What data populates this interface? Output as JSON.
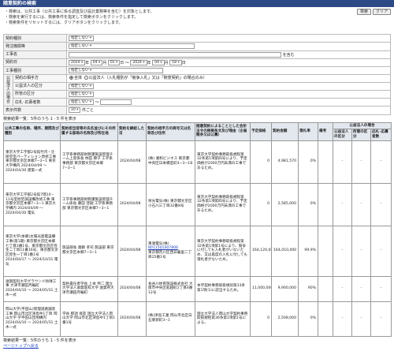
{
  "page_title": "随意契約の検索",
  "notes": [
    "・検索は、公共工事（公共工事に係る調査及び設計業務等を含む）を対象とします。",
    "・検索を実行するには、検索条件を指定して検索ボタンをクリックします。",
    "・検索条件をリセットするには、クリアボタンをクリックします。"
  ],
  "buttons": {
    "search": "検索",
    "clear": "クリア"
  },
  "form": {
    "contract_type_label": "契約種別",
    "contract_type_value": "指定しない",
    "orderer_label": "発注機関等",
    "orderer_value": "指定しない",
    "work_name_label": "工事名",
    "includes": "を含む",
    "date_label": "契約日",
    "date_from": {
      "year": "2024",
      "year_u": "年",
      "month": "04",
      "month_u": "月",
      "day": "01",
      "day_u": "日"
    },
    "tilde": "〜",
    "date_to": {
      "year": "2024",
      "year_u": "年",
      "month": "04",
      "month_u": "月",
      "day": "18",
      "day_u": "日"
    },
    "work_type_label": "工事種別",
    "work_type_value": "指定しない",
    "group_label": "公益法人の場合",
    "counterparty_label": "契約の相手方",
    "radio_all": "全体",
    "radio_public": "公益法人（入札種別が「競争入札」又は「随意契約」の場合のみ）",
    "category_label": "公益法人の区分",
    "category_value": "指定しない",
    "ministry_label": "所管の区分",
    "ministry_value": "指定しない",
    "bidders_label": "応札･応募者数",
    "bidders_value": "指定しない",
    "display_label": "表示件数",
    "display_value": "10",
    "display_unit": "件ごと"
  },
  "summary": "検索結果一覧：5件のうち 1 - 5 件を表示",
  "table": {
    "headers": {
      "work_name": "公共工事の名称、場所、期間及び種別",
      "official": "契約担当官等の氏名並びにその所属する部局の名称及び所在地",
      "date": "契約を締結した日",
      "contractor": "契約の相手方の商号又は名称及び住所",
      "reason": "随意契約によることとした会計法令の根拠条文及び理由（企画競争又は公募）",
      "estimate": "予定価格",
      "amount": "契約金額",
      "rate": "落札率",
      "note": "備考",
      "group": "公益法人の場合",
      "category": "公益法人の区分",
      "ministry": "所管の区分",
      "bidders": "応札･応募者数"
    },
    "rows": [
      {
        "work_name": "東京大学工学部2号館竹内・辻研究室パーティション改修工事 東京都文京区本郷7−3−1 東京大学構内 2024/04/09 〜 2024/04/30 建築一式",
        "official": "工学系事務部財務課施設管理チーム上席係長 林田 節子 工学系事務部 東京都文京区本郷7−3−1",
        "date": "2024/04/08",
        "contractor": "(株) 湘和ビジネス 東京都中央区日本橋室町4−3−18",
        "contractor_link": "",
        "reason": "東京大学契約事務取扱規程第32条第1項第四号により、予定価格が2000万円未満の工事であるため。",
        "estimate": "0",
        "amount": "4,981,570",
        "rate": "0%",
        "note": "",
        "category": "-",
        "ministry": "-",
        "bidders": "-"
      },
      {
        "work_name": "東京大学工学部2号館7階10・11号室他空調設備改修工事 東京都文京区本郷7−3−1 東京大学構内 2024/04/09 〜 2024/04/30 電気",
        "official": "工学系事務部財務課施設管理チーム係長 藤田 啓嗣 工学系事務部 東京都文京区本郷7−3−1",
        "date": "2024/04/08",
        "contractor": "栄光電気(株) 東京都文京区小石川三丁目32番8号",
        "contractor_link": "",
        "reason": "東京大学契約事務取扱規程第32条第1項第四号により、予定価格が2000万円未満の工事であるため。",
        "estimate": "0",
        "amount": "2,585,000",
        "rate": "0%",
        "note": "",
        "category": "-",
        "ministry": "-",
        "bidders": "-"
      },
      {
        "work_name": "東京大学(本郷)太陽光発電設備工事(第1期) 東京都文京区本郷七丁目3番1号、東京都文京区弥生二丁目11番16号、東京都文京区弥生一丁目1番1号 2024/04/17 〜 2024/10/31 電気",
        "official": "施設部長 齋藤 孝司 施設部 東京都文京区本郷7−3−1",
        "date": "2024/04/08",
        "contractor": "東湖電気(株)",
        "contractor_link": "8011501007806",
        "contractor_addr": "東京都荒川区西日暮里二丁目25番1号",
        "reason": "東京大学契約事務取扱規程第32条第1項第1号により、競争に付しても入札者がいないため、又は再度の入札に付しても落札者がないため。",
        "estimate": "164,120,000",
        "amount": "164,010,000",
        "rate": "99.9%",
        "note": "",
        "category": "-",
        "ministry": "-",
        "bidders": "-"
      },
      {
        "work_name": "滋賀医科大学グラウンド防球工事 大津市瀬田月輪町 2024/04/10 〜 2024/05/31 土木一式",
        "official": "契約責任者学長 上本 伸二 国立大学法人滋賀医科大学 滋賀県大津市瀬田月輪町",
        "date": "2024/04/08",
        "contractor": "長谷川体育施設株式会社 大阪市中央区船越町2丁目4番12号",
        "contractor_link": "",
        "reason": "本学契約事務取扱規則第33条第1項(1)に該当するため。",
        "estimate": "11,000,000",
        "amount": "9,900,000",
        "rate": "90%",
        "note": "",
        "category": "-",
        "ministry": "-",
        "bidders": "-"
      },
      {
        "work_name": "岡山大学(平田山)管理道路舗装工事 岡山市北区津島中1丁目 岡山大学 学平田山団地構内 2024/04/10 〜 2024/05/31 土木一式",
        "official": "学長 那須 保友 国立大学法人岡山大学 岡山市北区津島中1丁目1番1号",
        "date": "2024/04/08",
        "contractor": "(株)津島工業 岡山市北区白石東新町3−1",
        "contractor_link": "",
        "reason": "国立大学法人岡山大学契約事務取扱規程第36条第1項第1号による。",
        "estimate": "0",
        "amount": "2,508,000",
        "rate": "0%",
        "note": "",
        "category": "-",
        "ministry": "-",
        "bidders": "-"
      }
    ]
  },
  "footer_summary": "検索結果一覧：5件のうち 1 - 5 件を表示",
  "page_top_link": "ページトップへ戻る"
}
